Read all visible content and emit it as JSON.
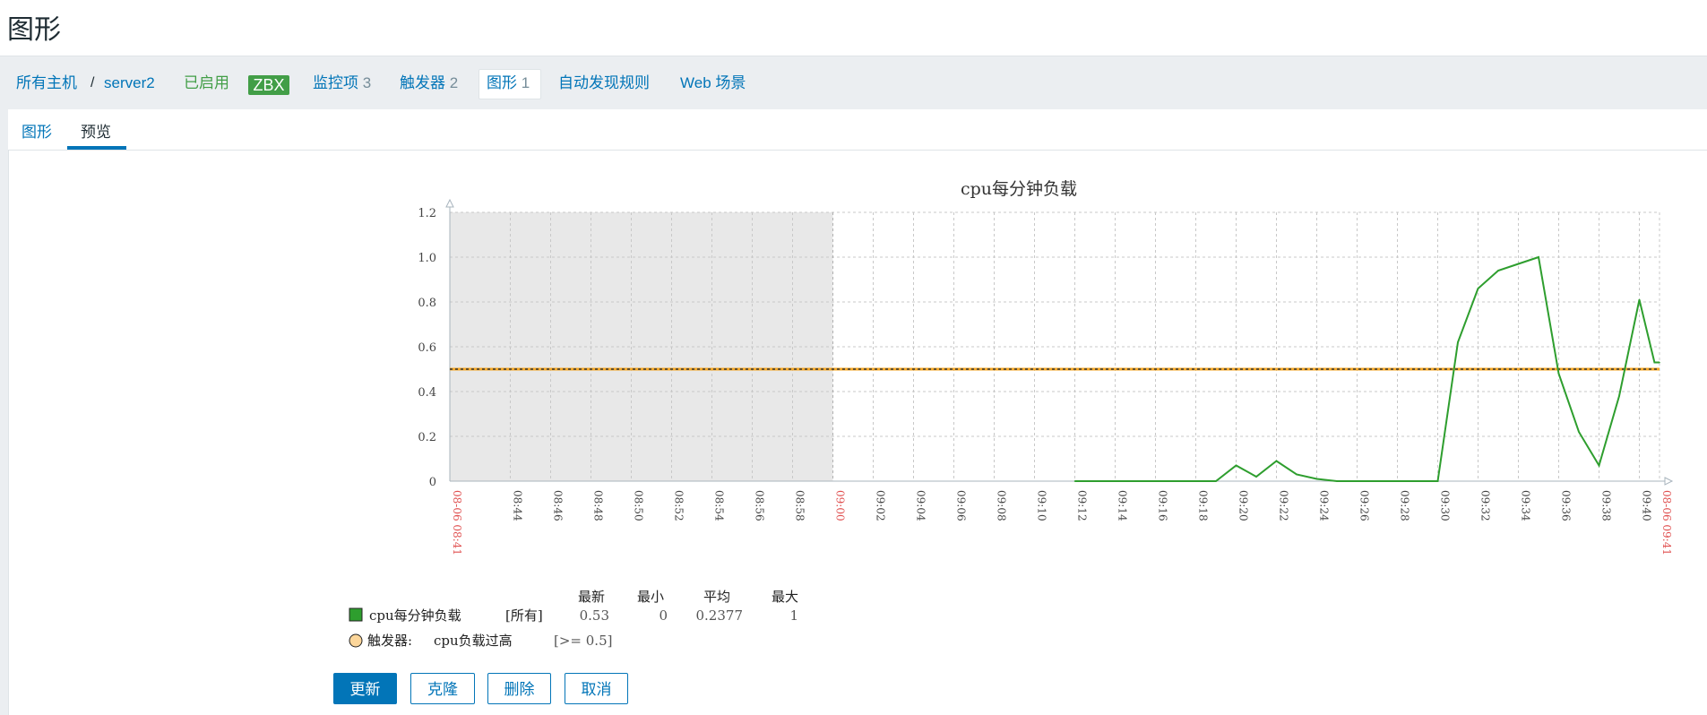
{
  "page": {
    "title": "图形"
  },
  "hostnav": {
    "all_hosts": "所有主机",
    "separator": "/",
    "host": "server2",
    "status": "已启用",
    "agent_badge": "ZBX",
    "items": {
      "label": "监控项",
      "count": "3"
    },
    "triggers": {
      "label": "触发器",
      "count": "2"
    },
    "graphs": {
      "label": "图形",
      "count": "1"
    },
    "discovery": "自动发现规则",
    "web": "Web 场景"
  },
  "tabs": [
    {
      "label": "图形",
      "active": false
    },
    {
      "label": "预览",
      "active": true
    }
  ],
  "colors": {
    "series": "#2e9e2e",
    "trigger": "#f5a623",
    "accent": "#0275b8",
    "enabled": "#429e47"
  },
  "chart_data": {
    "type": "line",
    "title": "cpu每分钟负载",
    "ylim": [
      0,
      1.2
    ],
    "yticks": [
      "0",
      "0.2",
      "0.4",
      "0.6",
      "0.8",
      "1.0",
      "1.2"
    ],
    "xrange": [
      "08:41",
      "09:41"
    ],
    "xticks": [
      "08:44",
      "08:46",
      "08:48",
      "08:50",
      "08:52",
      "08:54",
      "08:56",
      "08:58",
      "09:00",
      "09:02",
      "09:04",
      "09:06",
      "09:08",
      "09:10",
      "09:12",
      "09:14",
      "09:16",
      "09:18",
      "09:20",
      "09:22",
      "09:24",
      "09:26",
      "09:28",
      "09:30",
      "09:32",
      "09:34",
      "09:36",
      "09:38",
      "09:40"
    ],
    "xtick_highlight": [
      "09:00"
    ],
    "start_label": "08-06 08:41",
    "end_label": "08-06 09:41",
    "nodata_until": "09:00",
    "grid": true,
    "series": [
      {
        "name": "cpu每分钟负载",
        "color": "#2e9e2e",
        "points": [
          [
            "09:12",
            0
          ],
          [
            "09:19",
            0
          ],
          [
            "09:20",
            0.07
          ],
          [
            "09:21",
            0.02
          ],
          [
            "09:22",
            0.09
          ],
          [
            "09:23",
            0.03
          ],
          [
            "09:24",
            0.01
          ],
          [
            "09:25",
            0
          ],
          [
            "09:30",
            0
          ],
          [
            "09:31",
            0.62
          ],
          [
            "09:32",
            0.86
          ],
          [
            "09:33",
            0.94
          ],
          [
            "09:34",
            0.97
          ],
          [
            "09:35",
            1.0
          ],
          [
            "09:36",
            0.48
          ],
          [
            "09:37",
            0.22
          ],
          [
            "09:38",
            0.07
          ],
          [
            "09:39",
            0.38
          ],
          [
            "09:40",
            0.81
          ],
          [
            "09:40:45",
            0.53
          ],
          [
            "09:41",
            0.53
          ]
        ]
      }
    ],
    "trigger": {
      "name": "cpu负载过高",
      "threshold": 0.5,
      "label": "[>= 0.5]",
      "color": "#f5a623"
    },
    "legend": {
      "headers": [
        "最新",
        "最小",
        "平均",
        "最大"
      ],
      "series_row": {
        "name": "cpu每分钟负载",
        "scope": "[所有]",
        "last": "0.53",
        "min": "0",
        "avg": "0.2377",
        "max": "1"
      },
      "trigger_row": {
        "prefix": "触发器:",
        "name": "cpu负载过高",
        "condition": "[>= 0.5]"
      }
    }
  },
  "buttons": {
    "update": "更新",
    "clone": "克隆",
    "delete": "删除",
    "cancel": "取消"
  }
}
